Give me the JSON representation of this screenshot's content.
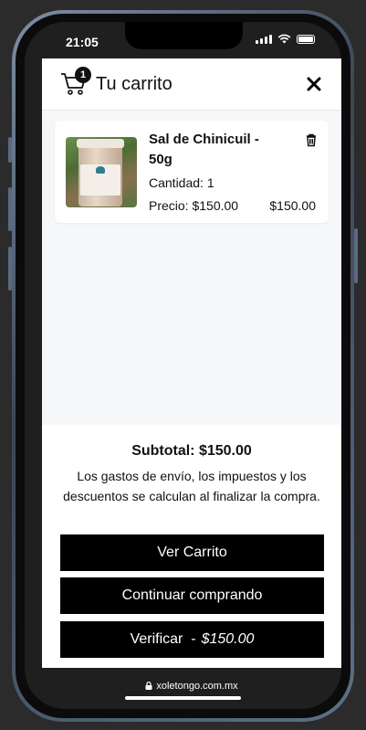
{
  "status_bar": {
    "time": "21:05"
  },
  "cart": {
    "title": "Tu carrito",
    "badge_count": "1",
    "item": {
      "name": "Sal de Chinicuil - 50g",
      "quantity": "Cantidad: 1",
      "price": "Precio: $150.00",
      "total": "$150.00"
    }
  },
  "footer": {
    "subtotal": "Subtotal: $150.00",
    "shipping_note": "Los gastos de envío, los impuestos y los descuentos se calculan al finalizar la compra.",
    "view_cart_label": "Ver Carrito",
    "continue_label": "Continuar comprando",
    "checkout_label": "Verificar  -",
    "checkout_amount": "$150.00"
  },
  "browser": {
    "url": "xoletongo.com.mx"
  },
  "icons": [
    "cart-icon",
    "close-icon",
    "trash-icon",
    "lock-icon",
    "wifi-icon",
    "battery-icon"
  ]
}
